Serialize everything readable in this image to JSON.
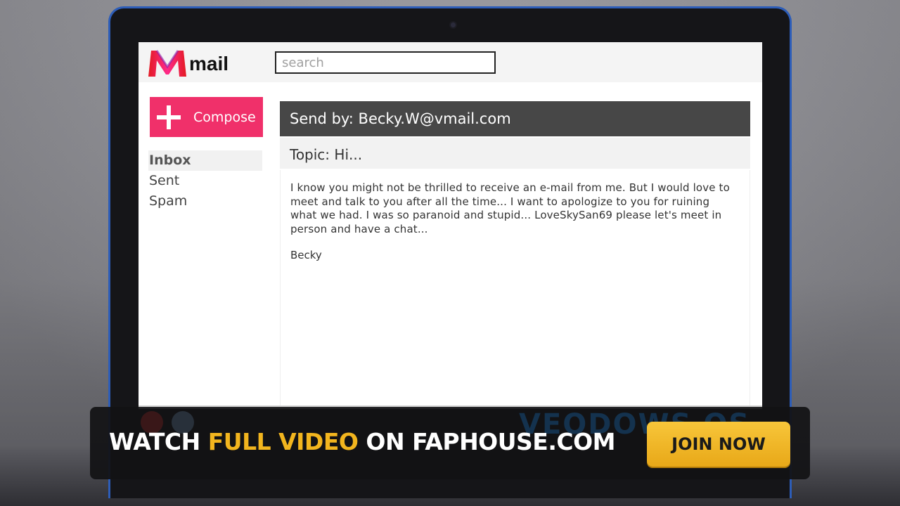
{
  "app": {
    "logo_text": "mail",
    "search_placeholder": "search",
    "brand_colors": {
      "compose": "#f0306a",
      "header": "#474747",
      "bezel": "#2d5db8"
    }
  },
  "sidebar": {
    "compose_label": "Compose",
    "items": [
      {
        "label": "Inbox",
        "active": true
      },
      {
        "label": "Sent",
        "active": false
      },
      {
        "label": "Spam",
        "active": false
      }
    ]
  },
  "message": {
    "sender_line": "Send by: Becky.W@vmail.com",
    "topic_line": "Topic: Hi...",
    "body": "I know you might not be thrilled to receive an e-mail from me. But I would love to meet and talk to you after all the time... I want to apologize to you for ruining what we had. I was so paranoid and stupid... LoveSkySan69 please let's meet in person and have a chat...",
    "signature": "Becky"
  },
  "banner": {
    "watch_prefix": "WATCH ",
    "watch_highlight": "FULL VIDEO",
    "watch_suffix": " ON FAPHOUSE.COM",
    "join_label": "JOIN NOW",
    "ghost_brand": "VEODOWS OS"
  }
}
